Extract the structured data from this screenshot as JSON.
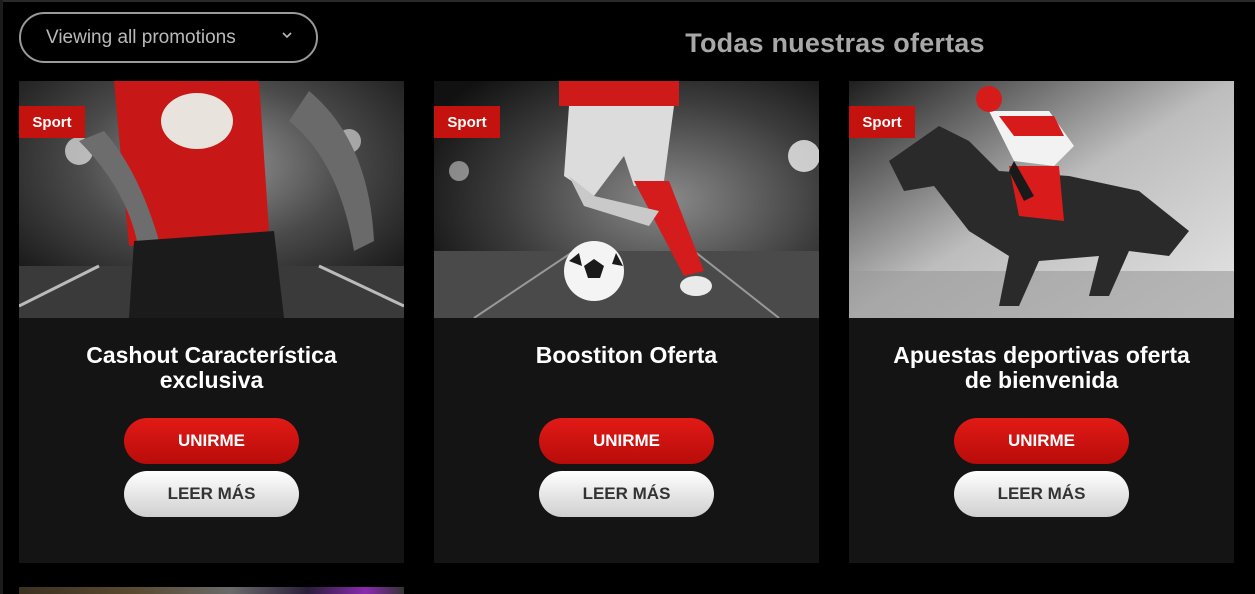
{
  "filter": {
    "label": "Viewing all promotions",
    "icon": "chevron-down-icon"
  },
  "heading": "Todas nuestras ofertas",
  "colors": {
    "accent": "#c4120f",
    "background": "#000000",
    "card": "#141414"
  },
  "cards": [
    {
      "badge": "Sport",
      "title_line1": "Cashout Característica",
      "title_line2": "exclusiva",
      "join_label": "UNIRME",
      "more_label": "LEER MÁS",
      "image": "rugby-player-image"
    },
    {
      "badge": "Sport",
      "title_line1": "Boostiton Oferta",
      "title_line2": "",
      "join_label": "UNIRME",
      "more_label": "LEER MÁS",
      "image": "soccer-player-image"
    },
    {
      "badge": "Sport",
      "title_line1": "Apuestas deportivas oferta",
      "title_line2": "de bienvenida",
      "join_label": "UNIRME",
      "more_label": "LEER MÁS",
      "image": "horse-racing-image"
    }
  ]
}
